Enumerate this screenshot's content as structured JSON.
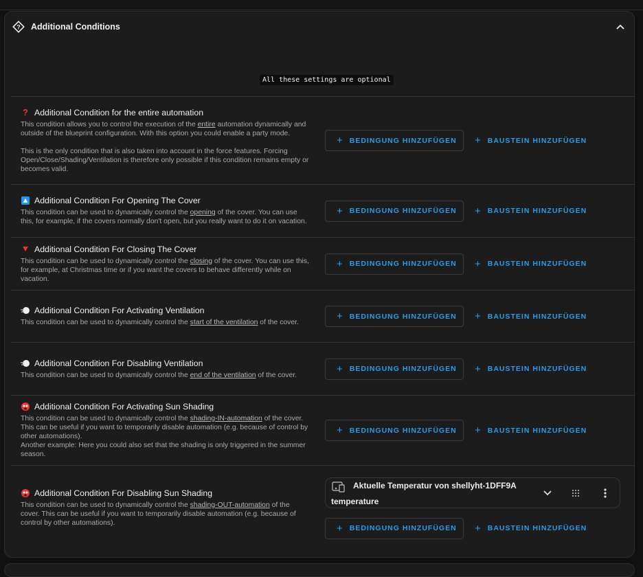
{
  "section": {
    "title": "Additional Conditions",
    "optional_note": "All these settings are optional"
  },
  "buttons": {
    "add_condition": "BEDINGUNG HINZUFÜGEN",
    "add_building_block": "BAUSTEIN HINZUFÜGEN"
  },
  "conditions": [
    {
      "icon": "question-mark-icon",
      "title": "Additional Condition for the entire automation",
      "desc_pre": "This condition allows you to control the execution of the ",
      "desc_link": "entire",
      "desc_post": " automation dynamically and outside of the blueprint configuration. With this option you could enable a party mode.",
      "desc_extra": "This is the only condition that is also taken into account in the force features. Forcing Open/Close/Shading/Ventilation is therefore only possible if this condition remains empty or becomes valid."
    },
    {
      "icon": "up-button-icon",
      "title": "Additional Condition For Opening The Cover",
      "desc_pre": "This condition can be used to dynamically control the ",
      "desc_link": "opening",
      "desc_post": " of the cover. You can use this, for example, if the covers normally don't open, but you really want to do it on vacation."
    },
    {
      "icon": "down-triangle-icon",
      "title": "Additional Condition For Closing The Cover",
      "desc_pre": "This condition can be used to dynamically control the ",
      "desc_link": "closing",
      "desc_post": " of the cover. You can use this, for example, at Christmas time or if you want the covers to behave differently while on vacation."
    },
    {
      "icon": "wind-icon",
      "title": "Additional Condition For Activating Ventilation",
      "desc_pre": "This condition can be used to dynamically control the ",
      "desc_link": "start of the ventilation",
      "desc_post": " of the cover."
    },
    {
      "icon": "wind-icon",
      "title": "Additional Condition For Disabling Ventilation",
      "desc_pre": "This condition can be used to dynamically control the ",
      "desc_link": "end of the ventilation",
      "desc_post": " of the cover."
    },
    {
      "icon": "hot-face-icon",
      "title": "Additional Condition For Activating Sun Shading",
      "desc_pre": "This condition can be used to dynamically control the ",
      "desc_link": "shading-IN-automation",
      "desc_post": " of the cover. This can be useful if you want to temporarily disable automation (e.g. because of control by other automations).",
      "desc_extra": "Another example: Here you could also set that the shading is only triggered in the summer season."
    },
    {
      "icon": "hot-face-icon",
      "title": "Additional Condition For Disabling Sun Shading",
      "desc_pre": "This condition can be used to dynamically control the ",
      "desc_link": "shading-OUT-automation",
      "desc_post": " of the cover. This can be useful if you want to temporarily disable automation (e.g. because of control by other automations)."
    }
  ],
  "entity_condition": {
    "name": "Aktuelle Temperatur von shellyht-1DFF9A",
    "attribute": "temperature"
  },
  "colors": {
    "accent": "#2a9bea",
    "card_bg": "#1c1c1c",
    "page_bg": "#111111"
  }
}
